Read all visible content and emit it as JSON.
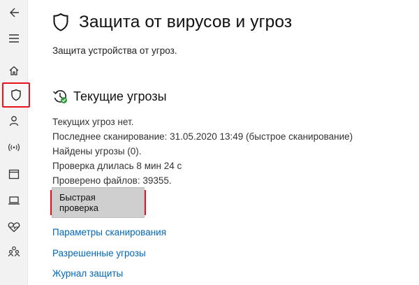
{
  "page": {
    "title": "Защита от вирусов и угроз",
    "subtitle": "Защита устройства от угроз."
  },
  "sidebar": {
    "items": [
      {
        "name": "back",
        "icon": "back-arrow-icon"
      },
      {
        "name": "menu",
        "icon": "hamburger-icon"
      },
      {
        "name": "home",
        "icon": "home-icon"
      },
      {
        "name": "virus-protection",
        "icon": "shield-icon",
        "active": true
      },
      {
        "name": "account",
        "icon": "person-icon"
      },
      {
        "name": "firewall",
        "icon": "wireless-icon"
      },
      {
        "name": "app-browser",
        "icon": "window-icon"
      },
      {
        "name": "device-security",
        "icon": "laptop-icon"
      },
      {
        "name": "device-health",
        "icon": "heart-icon"
      },
      {
        "name": "family",
        "icon": "family-icon"
      }
    ]
  },
  "threats": {
    "title": "Текущие угрозы",
    "lines": [
      "Текущих угроз нет.",
      "Последнее сканирование: 31.05.2020 13:49 (быстрое сканирование)",
      "Найдены угрозы (0).",
      "Проверка длилась 8 мин 24 с",
      "Проверено файлов: 39355."
    ],
    "quick_scan_label": "Быстрая проверка"
  },
  "links": {
    "scan_options": "Параметры сканирования",
    "allowed_threats": "Разрешенные угрозы",
    "protection_history": "Журнал защиты"
  },
  "colors": {
    "accent_link": "#0067b8",
    "highlight_red": "#e8131b",
    "status_green": "#2e9b3e"
  }
}
